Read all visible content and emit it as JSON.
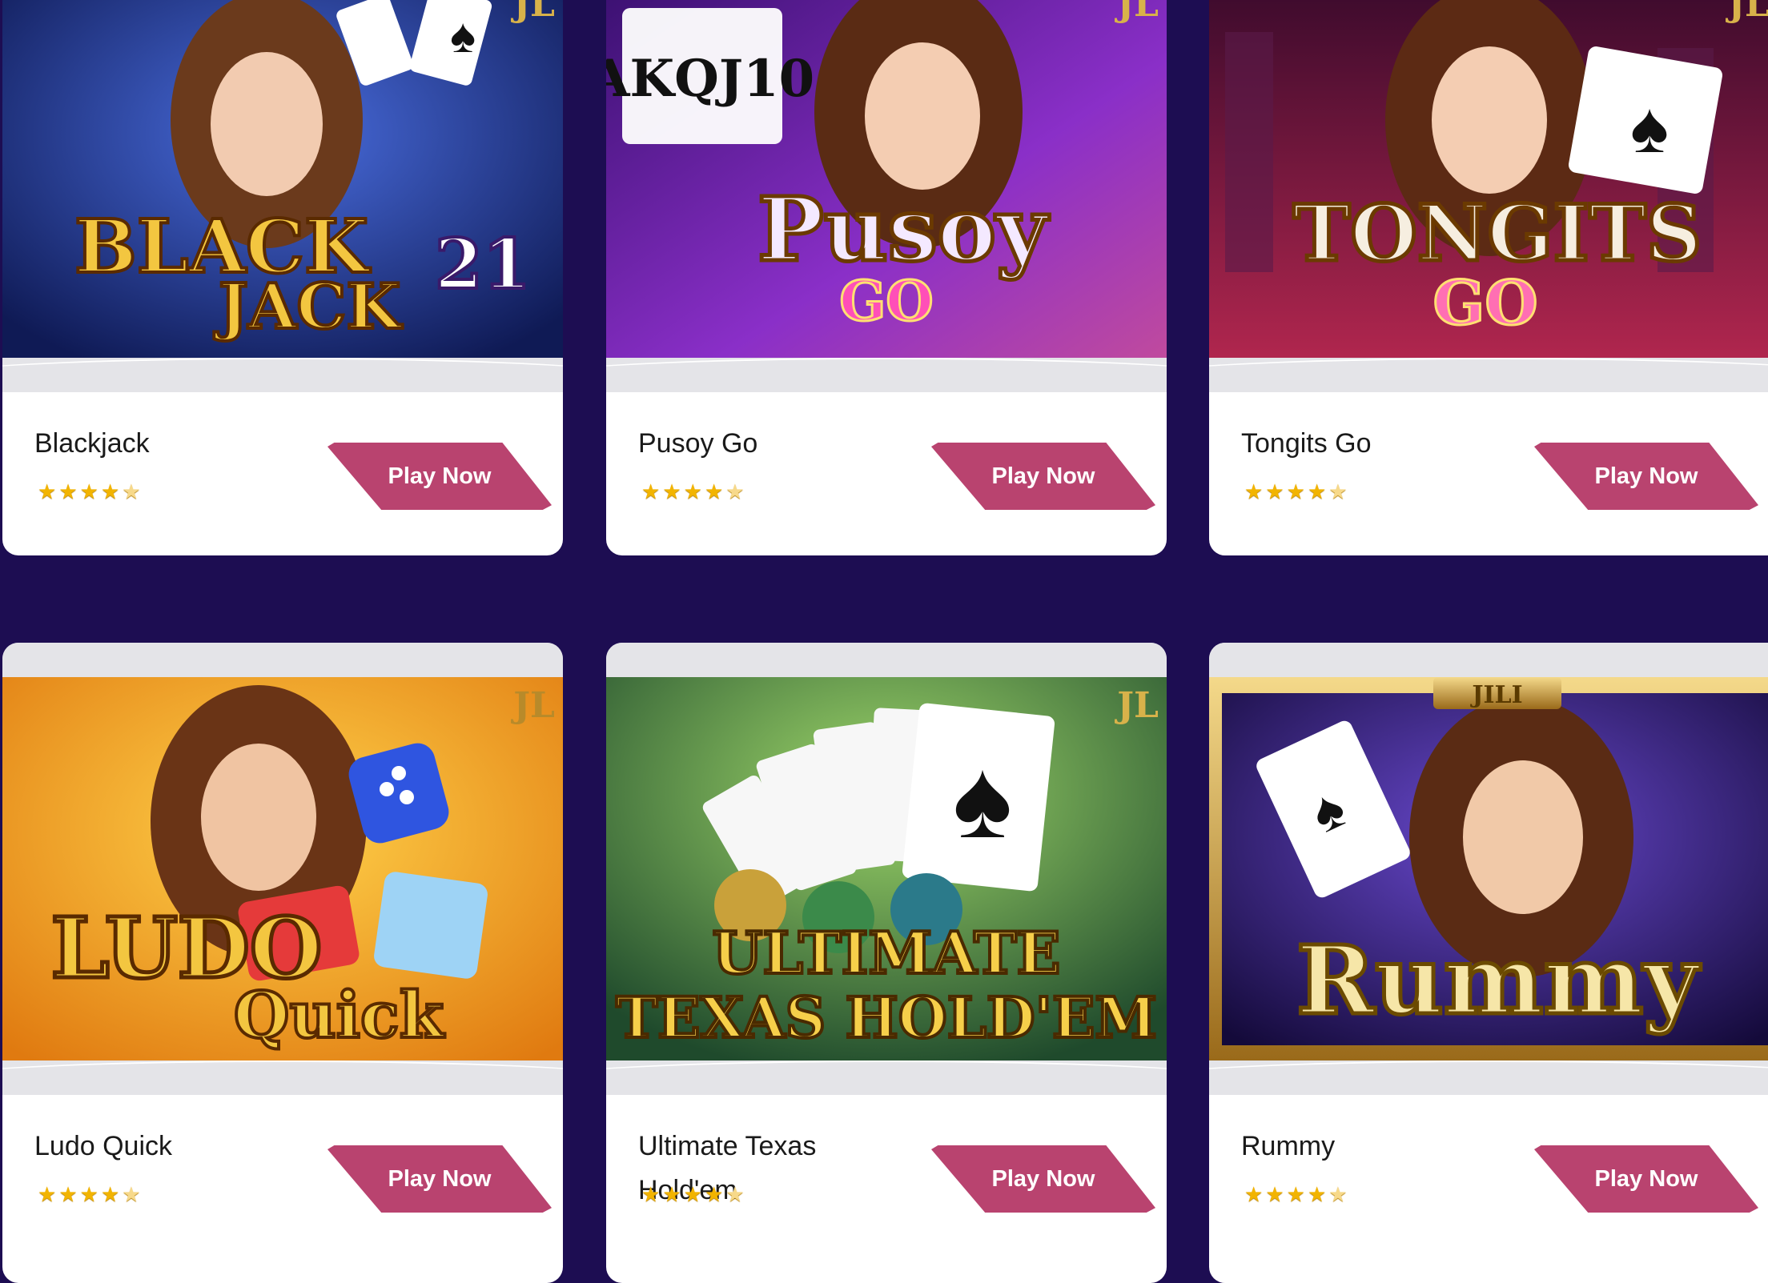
{
  "games": [
    {
      "name": "Blackjack",
      "logo": [
        "BLACK",
        "JACK",
        "21"
      ],
      "badge": "JL",
      "rating": 4.5,
      "button": "Play Now",
      "theme": "#2a3e9a"
    },
    {
      "name": "Pusoy Go",
      "logo": [
        "Pusoy",
        "GO"
      ],
      "badge": "JL",
      "rating": 4.5,
      "button": "Play Now",
      "theme": "#7a2fb0"
    },
    {
      "name": "Tongits Go",
      "logo": [
        "TONGITS",
        "GO"
      ],
      "badge": "JL",
      "rating": 4.5,
      "button": "Play Now",
      "theme": "#a0214e"
    },
    {
      "name": "Ludo Quick",
      "logo": [
        "LUDO",
        "Quick"
      ],
      "badge": "JL",
      "rating": 4.5,
      "button": "Play Now",
      "theme": "#e8961f"
    },
    {
      "name": "Ultimate Texas Hold'em",
      "logo": [
        "ULTIMATE",
        "TEXAS HOLD'EM"
      ],
      "badge": "JL",
      "rating": 4.5,
      "button": "Play Now",
      "theme": "#2f6b3e"
    },
    {
      "name": "Rummy",
      "logo": [
        "Rummy"
      ],
      "badge": "JILI",
      "rating": 4.5,
      "button": "Play Now",
      "theme": "#3a1f6e"
    }
  ],
  "colors": {
    "page_bg": "#1d0d52",
    "button": "#b9436f",
    "star": "#f2b400"
  },
  "icons": {
    "star": "star-icon"
  }
}
